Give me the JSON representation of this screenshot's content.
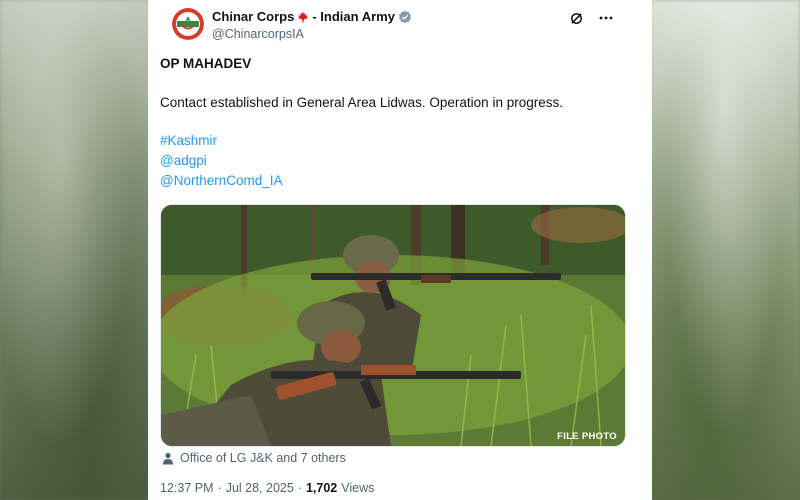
{
  "account": {
    "name": "Chinar Corps",
    "name_suffix": " - Indian Army",
    "handle": "@ChinarcorpsIA",
    "icons": [
      "maple-leaf-icon",
      "verified-badge-icon",
      "grok-icon",
      "more-icon"
    ]
  },
  "post": {
    "title": "OP MAHADEV",
    "text": "Contact established in General Area Lidwas. Operation in progress.",
    "links": [
      "#Kashmir",
      "@adgpi",
      "@NorthernComd_IA"
    ]
  },
  "media": {
    "caption": "FILE PHOTO"
  },
  "tagged": {
    "icon": "person-icon",
    "text": "Office of LG J&K and 7 others"
  },
  "meta": {
    "time": "12:37 PM",
    "separator": "·",
    "date": "Jul 28, 2025",
    "views_count": "1,702",
    "views_label": "Views"
  },
  "colors": {
    "link": "#1d9bf0",
    "text": "#0f1419",
    "muted": "#536471",
    "verified": "#829aab",
    "maple": "#d81e1e"
  }
}
